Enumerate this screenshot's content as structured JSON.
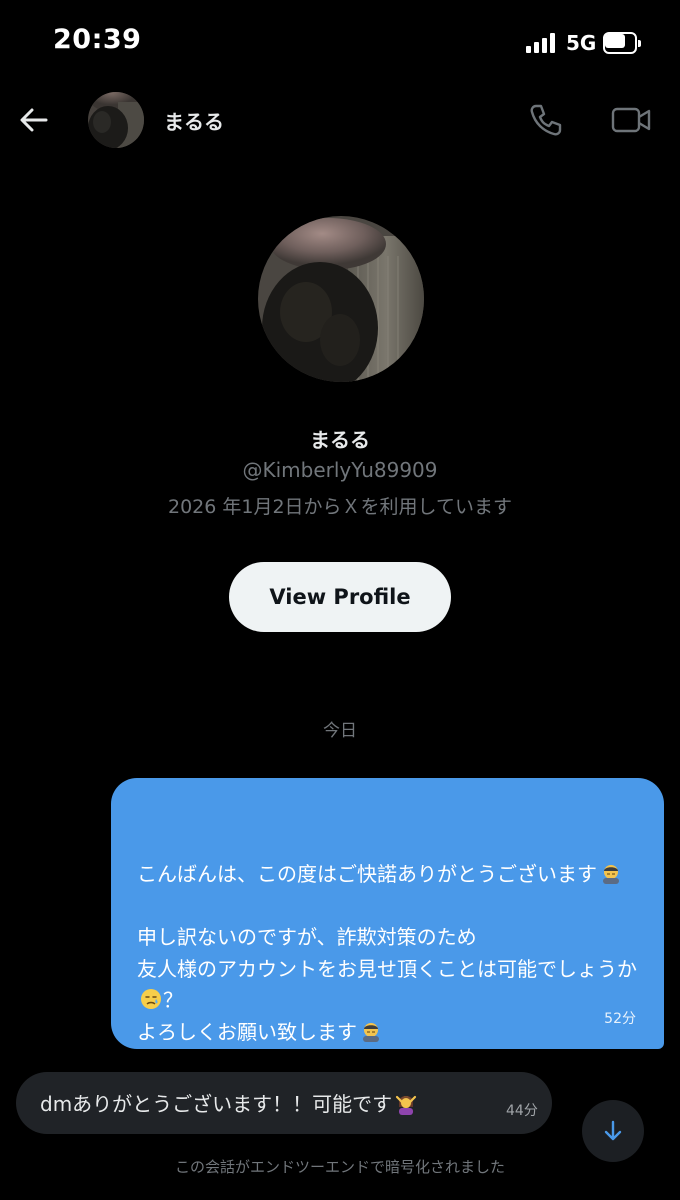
{
  "status_bar": {
    "time": "20:39",
    "network": "5G",
    "battery_level": 0.75,
    "signal_bars": 4
  },
  "header": {
    "back_icon": "back-arrow-icon",
    "name": "まるる",
    "call_icon": "phone-icon",
    "video_icon": "video-camera-icon"
  },
  "profile": {
    "name": "まるる",
    "handle": "@KimberlyYu89909",
    "joined": "2026 年1月2日からＸを利用しています",
    "view_profile_label": "View Profile"
  },
  "conversation": {
    "date_divider": "今日",
    "messages": [
      {
        "direction": "sent",
        "lines": [
          "こんばんは、この度はご快諾ありがとうございます",
          "",
          "申し訳ないのですが、詐欺対策のため",
          "友人様のアカウントをお見せ頂くことは可能でしょうか",
          "よろしくお願い致します"
        ],
        "line_suffix": "？",
        "emojis": [
          "bowing-person-emoji",
          "crying-face-emoji",
          "bowing-person-emoji"
        ],
        "time": "52分"
      },
      {
        "direction": "received",
        "text": "dmありがとうございます！！可能です",
        "emojis": [
          "ok-gesture-person-emoji"
        ],
        "time": "44分"
      }
    ],
    "encryption_notice": "この会話がエンドツーエンドで暗号化されました"
  },
  "colors": {
    "background": "#000000",
    "sent_bubble": "#4a99e9",
    "received_bubble": "#202327",
    "muted_text": "#71767b",
    "button_bg": "#eff3f4"
  },
  "icons": {
    "scroll_down": "arrow-down-icon"
  }
}
